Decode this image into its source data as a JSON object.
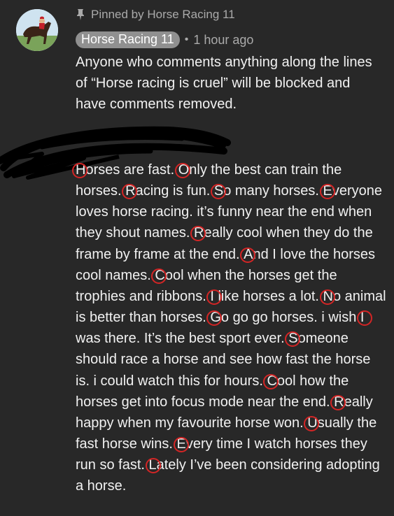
{
  "pinned_comment": {
    "pinned_label": "Pinned by Horse Racing 11",
    "author": "Horse Racing 11",
    "separator": "•",
    "time": "1 hour ago",
    "text": "Anyone who comments anything along the lines of “Horse racing is cruel” will be blocked and have comments removed."
  },
  "reply": {
    "sentences": [
      "Horses are fast.",
      "Only the best can train the horses.",
      "Racing is fun.",
      "So many horses.",
      "Everyone loves horse racing. it’s funny near the end when they shout names.",
      "Really cool when they do the frame by frame at the end.",
      "And I love the horses cool names.",
      "Cool when the horses get the trophies and ribbons.",
      "I like horses a lot.",
      "No animal is better than horses.",
      "Go go go horses. i wish",
      "I was there. It’s the best sport ever.",
      "Someone should race a horse and see how fast the horse is. i could watch this for hours.",
      "Cool how the horses get into focus mode near the end.",
      "Really happy when my favourite horse won.",
      "Usually the fast horse wins.",
      "Every time I watch horses they run so fast.",
      "Lately I’ve been considering adopting a horse."
    ]
  },
  "colors": {
    "background": "#282828",
    "text": "#f1f1f1",
    "muted": "#aaaaaa",
    "chip": "#909090",
    "ring": "#d42525",
    "scribble": "#000000"
  },
  "icons": [
    "pin-icon",
    "avatar-horse-jockey-image"
  ]
}
